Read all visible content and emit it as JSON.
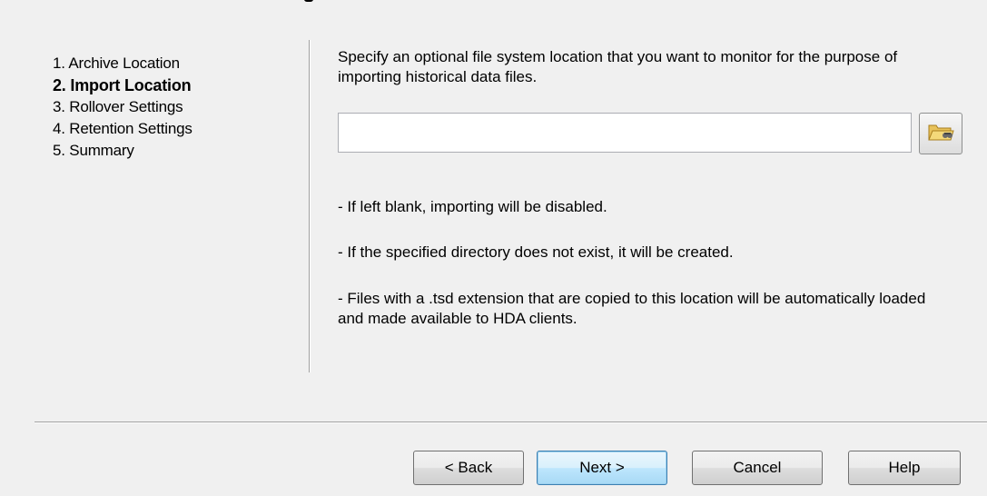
{
  "steps": [
    {
      "label": "1. Archive Location",
      "active": false
    },
    {
      "label": "2. Import Location",
      "active": true
    },
    {
      "label": "3. Rollover Settings",
      "active": false
    },
    {
      "label": "4. Retention Settings",
      "active": false
    },
    {
      "label": "5. Summary",
      "active": false
    }
  ],
  "main": {
    "description": "Specify an optional file system location that you want to monitor for the purpose of importing historical data files.",
    "path_value": "",
    "path_placeholder": "",
    "browse_icon": "folder-browse-icon",
    "notes": [
      "- If left blank, importing will be disabled.",
      "- If the specified directory does not exist, it will be created.",
      "- Files with a .tsd extension that are copied to this location will be automatically loaded and made available to HDA clients."
    ]
  },
  "buttons": {
    "back": "< Back",
    "next": "Next >",
    "cancel": "Cancel",
    "help": "Help"
  }
}
